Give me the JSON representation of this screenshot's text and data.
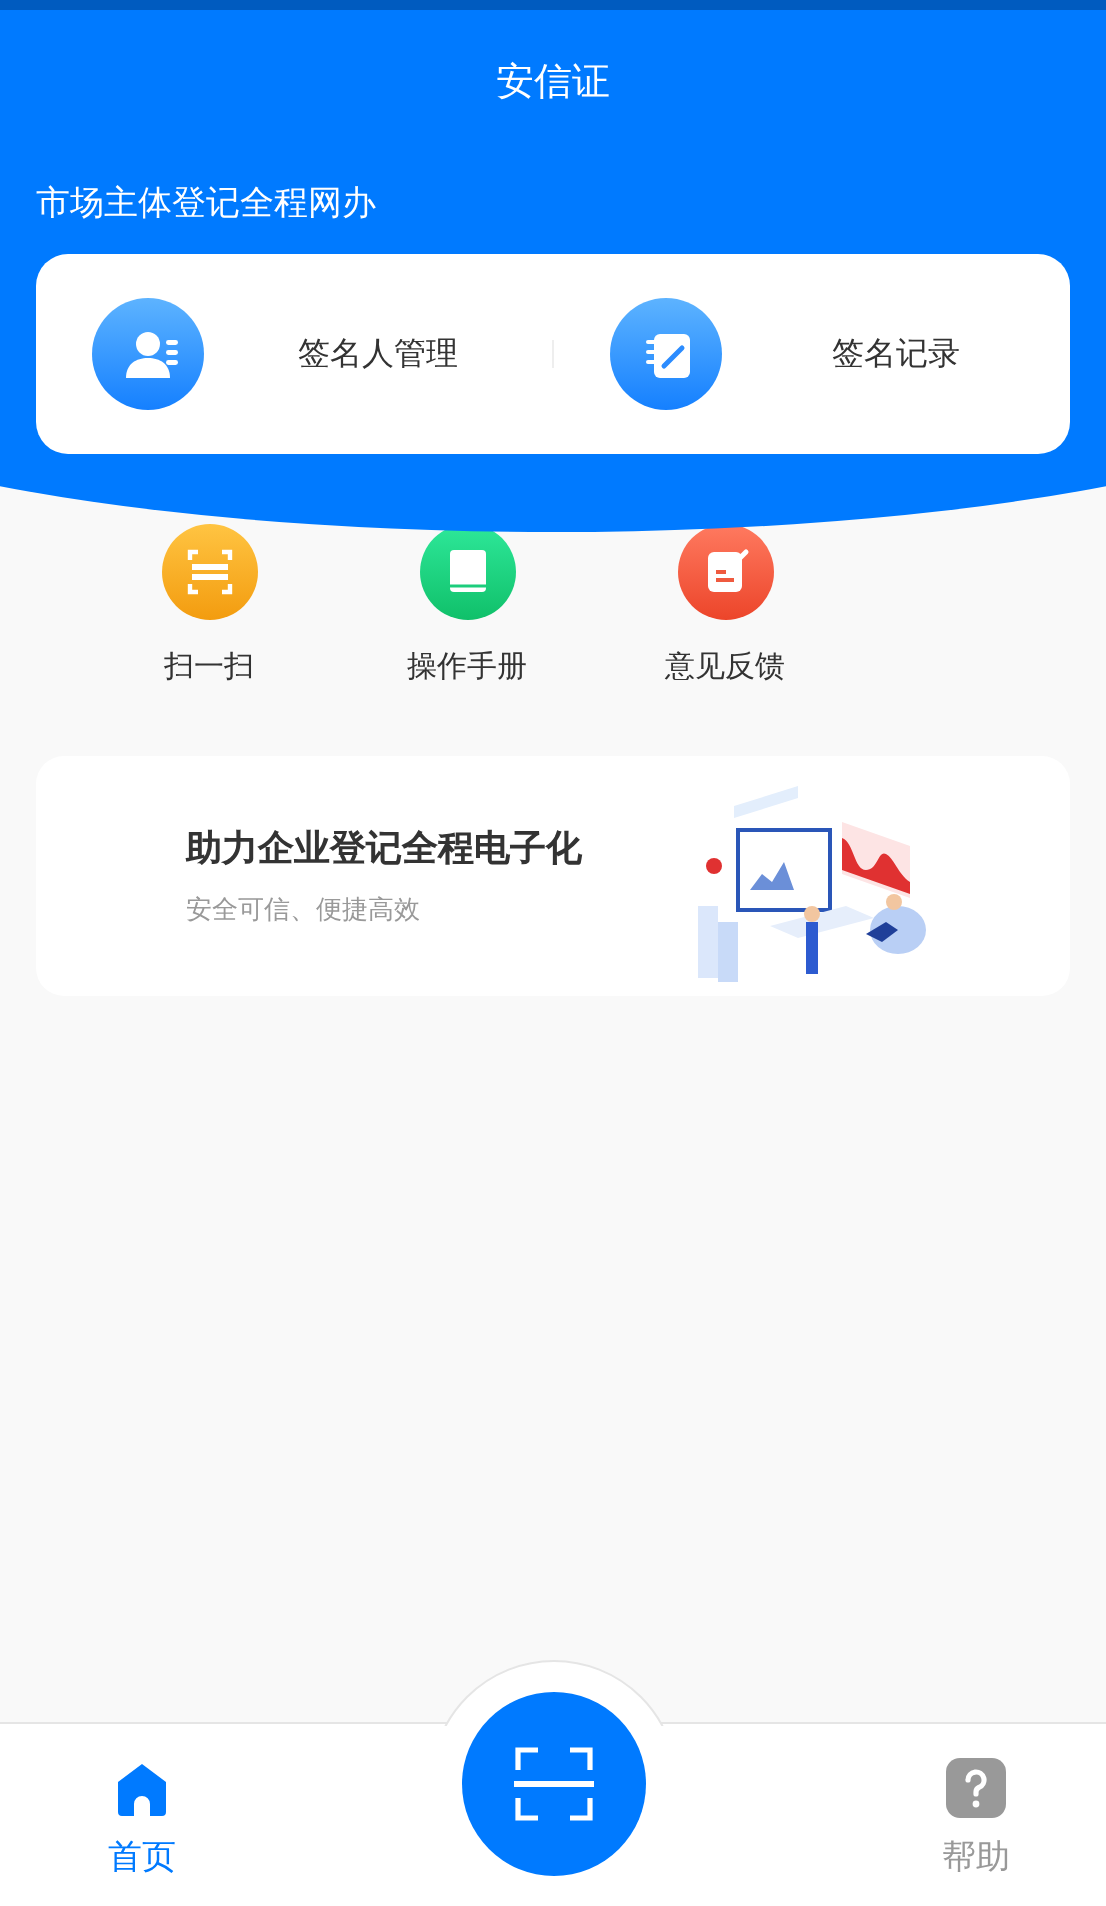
{
  "header": {
    "title": "安信证",
    "subtitle": "市场主体登记全程网办"
  },
  "main_actions": [
    {
      "kind": "signer",
      "label": "签名人管理"
    },
    {
      "kind": "record",
      "label": "签名记录"
    }
  ],
  "quick_actions": [
    {
      "kind": "scan",
      "label": "扫一扫"
    },
    {
      "kind": "manual",
      "label": "操作手册"
    },
    {
      "kind": "feedback",
      "label": "意见反馈"
    }
  ],
  "banner": {
    "title": "助力企业登记全程电子化",
    "subtitle": "安全可信、便捷高效"
  },
  "tab_bar": [
    {
      "kind": "home",
      "label": "首页",
      "selected": true
    },
    {
      "kind": "scan"
    },
    {
      "kind": "help",
      "label": "帮助",
      "selected": false
    }
  ]
}
